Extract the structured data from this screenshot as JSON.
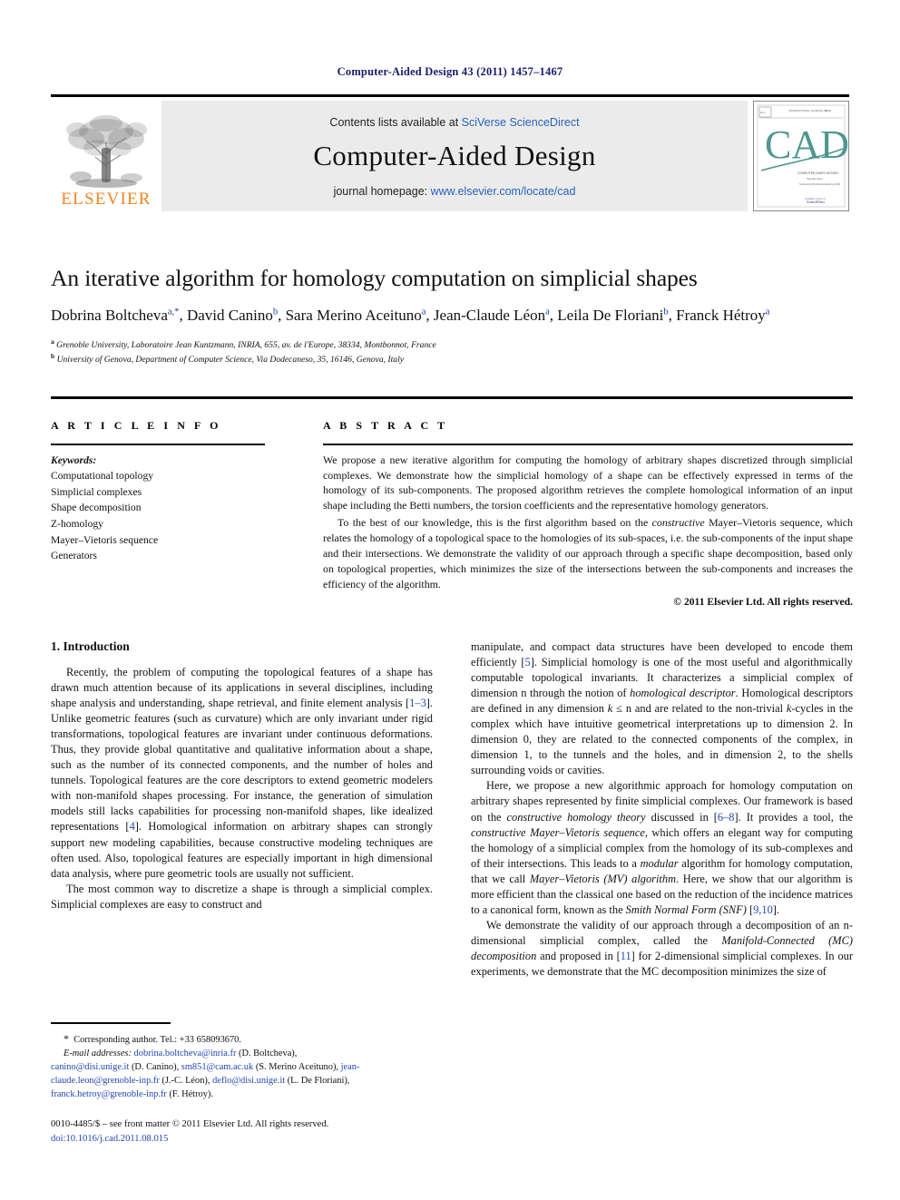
{
  "running_head": "Computer-Aided Design 43 (2011) 1457–1467",
  "masthead": {
    "publisher_name": "ELSEVIER",
    "contents_prefix": "Contents lists available at ",
    "contents_link": "SciVerse ScienceDirect",
    "journal_name": "Computer-Aided Design",
    "homepage_prefix": "journal homepage: ",
    "homepage_link": "www.elsevier.com/locate/cad",
    "cover": {
      "top_left_mark": "ELSEVIER",
      "top_center_line": "INTERNATIONAL JOURNAL OF",
      "top_right_line": "ISSN 0010-4485",
      "big_title": "CAD",
      "sub_line_1": "COMPUTER-AIDED DESIGN",
      "sub_line_2": "Special issue",
      "sub_line_3": "Solid and Physical Modeling 2010",
      "bottom_line_1": "Available online at www.sciencedirect.com",
      "bottom_line_2": "ScienceDirect"
    },
    "accent_orange": "#F08522",
    "link_blue": "#2a62bc",
    "band_gray": "#ebebeb"
  },
  "title": "An iterative algorithm for homology computation on simplicial shapes",
  "authors": [
    {
      "name": "Dobrina Boltcheva",
      "marks": "a,*"
    },
    {
      "name": "David Canino",
      "marks": "b"
    },
    {
      "name": "Sara Merino Aceituno",
      "marks": "a"
    },
    {
      "name": "Jean-Claude Léon",
      "marks": "a"
    },
    {
      "name": "Leila De Floriani",
      "marks": "b"
    },
    {
      "name": "Franck Hétroy",
      "marks": "a"
    }
  ],
  "affiliations": [
    {
      "mark": "a",
      "text": "Grenoble University, Laboratoire Jean Kuntzmann, INRIA, 655, av. de l'Europe, 38334, Montbonnot, France"
    },
    {
      "mark": "b",
      "text": "University of Genova, Department of Computer Science, Via Dodecaneso, 35, 16146, Genova, Italy"
    }
  ],
  "article_info": {
    "heading": "A R T I C L E    I N F O",
    "keywords_label": "Keywords:",
    "keywords": [
      "Computational topology",
      "Simplicial complexes",
      "Shape decomposition",
      "Z-homology",
      "Mayer–Vietoris sequence",
      "Generators"
    ]
  },
  "abstract": {
    "heading": "A B S T R A C T",
    "paragraph_1": "We propose a new iterative algorithm for computing the homology of arbitrary shapes discretized through simplicial complexes. We demonstrate how the simplicial homology of a shape can be effectively expressed in terms of the homology of its sub-components. The proposed algorithm retrieves the complete homological information of an input shape including the Betti numbers, the torsion coefficients and the representative homology generators.",
    "paragraph_2_a": "To the best of our knowledge, this is the first algorithm based on the ",
    "paragraph_2_em": "constructive",
    "paragraph_2_b": " Mayer–Vietoris sequence, which relates the homology of a topological space to the homologies of its sub-spaces, i.e. the sub-components of the input shape and their intersections. We demonstrate the validity of our approach through a specific shape decomposition, based only on topological properties, which minimizes the size of the intersections between the sub-components and increases the efficiency of the algorithm.",
    "rights": "© 2011 Elsevier Ltd. All rights reserved."
  },
  "body": {
    "section_title": "1. Introduction",
    "left": {
      "p1_a": "Recently, the problem of computing the topological features of a shape has drawn much attention because of its applications in several disciplines, including shape analysis and understanding, shape retrieval, and finite element analysis [",
      "p1_ref1": "1–3",
      "p1_b": "]. Unlike geometric features (such as curvature) which are only invariant under rigid transformations, topological features are invariant under continuous deformations. Thus, they provide global quantitative and qualitative information about a shape, such as the number of its connected components, and the number of holes and tunnels. Topological features are the core descriptors to extend geometric modelers with non-manifold shapes processing. For instance, the generation of simulation models still lacks capabilities for processing non-manifold shapes, like idealized representations [",
      "p1_ref2": "4",
      "p1_c": "]. Homological information on arbitrary shapes can strongly support new modeling capabilities, because constructive modeling techniques are often used. Also, topological features are especially important in high dimensional data analysis, where pure geometric tools are usually not sufficient.",
      "p2": "The most common way to discretize a shape is through a simplicial complex. Simplicial complexes are easy to construct and"
    },
    "right": {
      "p1_a": "manipulate, and compact data structures have been developed to encode them efficiently [",
      "p1_ref1": "5",
      "p1_b": "]. Simplicial homology is one of the most useful and algorithmically computable topological invariants. It characterizes a simplicial complex of dimension n through the notion of ",
      "p1_em": "homological descriptor",
      "p1_c": ". Homological descriptors are defined in any dimension ",
      "p1_k": "k",
      "p1_le": " ≤ ",
      "p1_d": "n and are related to the non-trivial ",
      "p1_k2": "k",
      "p1_e": "-cycles in the complex which have intuitive geometrical interpretations up to dimension 2. In dimension 0, they are related to the connected components of the complex, in dimension 1, to the tunnels and the holes, and in dimension 2, to the shells surrounding voids or cavities.",
      "p2_a": "Here, we propose a new algorithmic approach for homology computation on arbitrary shapes represented by finite simplicial complexes. Our framework is based on the ",
      "p2_em1": "constructive homology theory",
      "p2_b": " discussed in [",
      "p2_ref1": "6–8",
      "p2_c": "]. It provides a tool, the ",
      "p2_em2": "constructive Mayer–Vietoris sequence",
      "p2_d": ", which offers an elegant way for computing the homology of a simplicial complex from the homology of its sub-complexes and of their intersections. This leads to a ",
      "p2_em3": "modular",
      "p2_e": " algorithm for homology computation, that we call ",
      "p2_em4": "Mayer–Vietoris (MV) algorithm",
      "p2_f": ". Here, we show that our algorithm is more efficient than the classical one based on the reduction of the incidence matrices to a canonical form, known as the ",
      "p2_em5": "Smith Normal Form (SNF)",
      "p2_g": " [",
      "p2_ref2": "9,10",
      "p2_h": "].",
      "p3_a": "We demonstrate the validity of our approach through a decomposition of an n-dimensional simplicial complex, called the ",
      "p3_em": "Manifold-Connected (MC) decomposition",
      "p3_b": " and proposed in [",
      "p3_ref": "11",
      "p3_c": "] for 2-dimensional simplicial complexes. In our experiments, we demonstrate that the MC decomposition minimizes the  size of"
    }
  },
  "footnotes": {
    "corresponding_star": "*",
    "corresponding": "Corresponding author. Tel.: +33 658093670.",
    "email_label": "E-mail addresses:",
    "emails": [
      {
        "address": "dobrina.boltcheva@inria.fr",
        "person": "(D. Boltcheva),"
      },
      {
        "address": "canino@disi.unige.it",
        "person": "(D. Canino),"
      },
      {
        "address": "sm851@cam.ac.uk",
        "person": "(S. Merino Aceituno),"
      },
      {
        "address": "jean-claude.leon@grenoble-inp.fr",
        "person": "(J.-C. Léon),"
      },
      {
        "address": "deflo@disi.unige.it",
        "person": "(L. De Floriani),"
      },
      {
        "address": "franck.hetroy@grenoble-inp.fr",
        "person": "(F. Hétroy)."
      }
    ]
  },
  "imprint": {
    "issn_line": "0010-4485/$ – see front matter © 2011 Elsevier Ltd. All rights reserved.",
    "doi_prefix": "doi:",
    "doi": "10.1016/j.cad.2011.08.015"
  }
}
